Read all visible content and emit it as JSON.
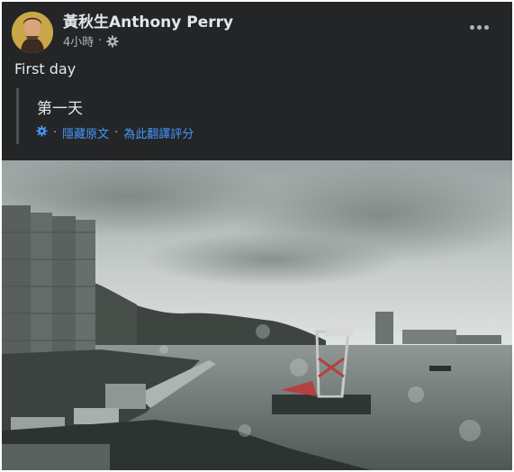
{
  "post": {
    "author": "黃秋生Anthony Perry",
    "time": "4小時",
    "separator": "·",
    "text": "First day",
    "translation": {
      "text": "第一天",
      "hide_original": "隱藏原文",
      "rate_translation": "為此翻譯評分"
    }
  },
  "icons": {
    "privacy": "gear-icon",
    "more": "more-dots-icon",
    "translate": "gear-icon"
  },
  "colors": {
    "background": "#242526",
    "text": "#e4e6eb",
    "secondary_text": "#b0b3b8",
    "link": "#4599ff"
  }
}
